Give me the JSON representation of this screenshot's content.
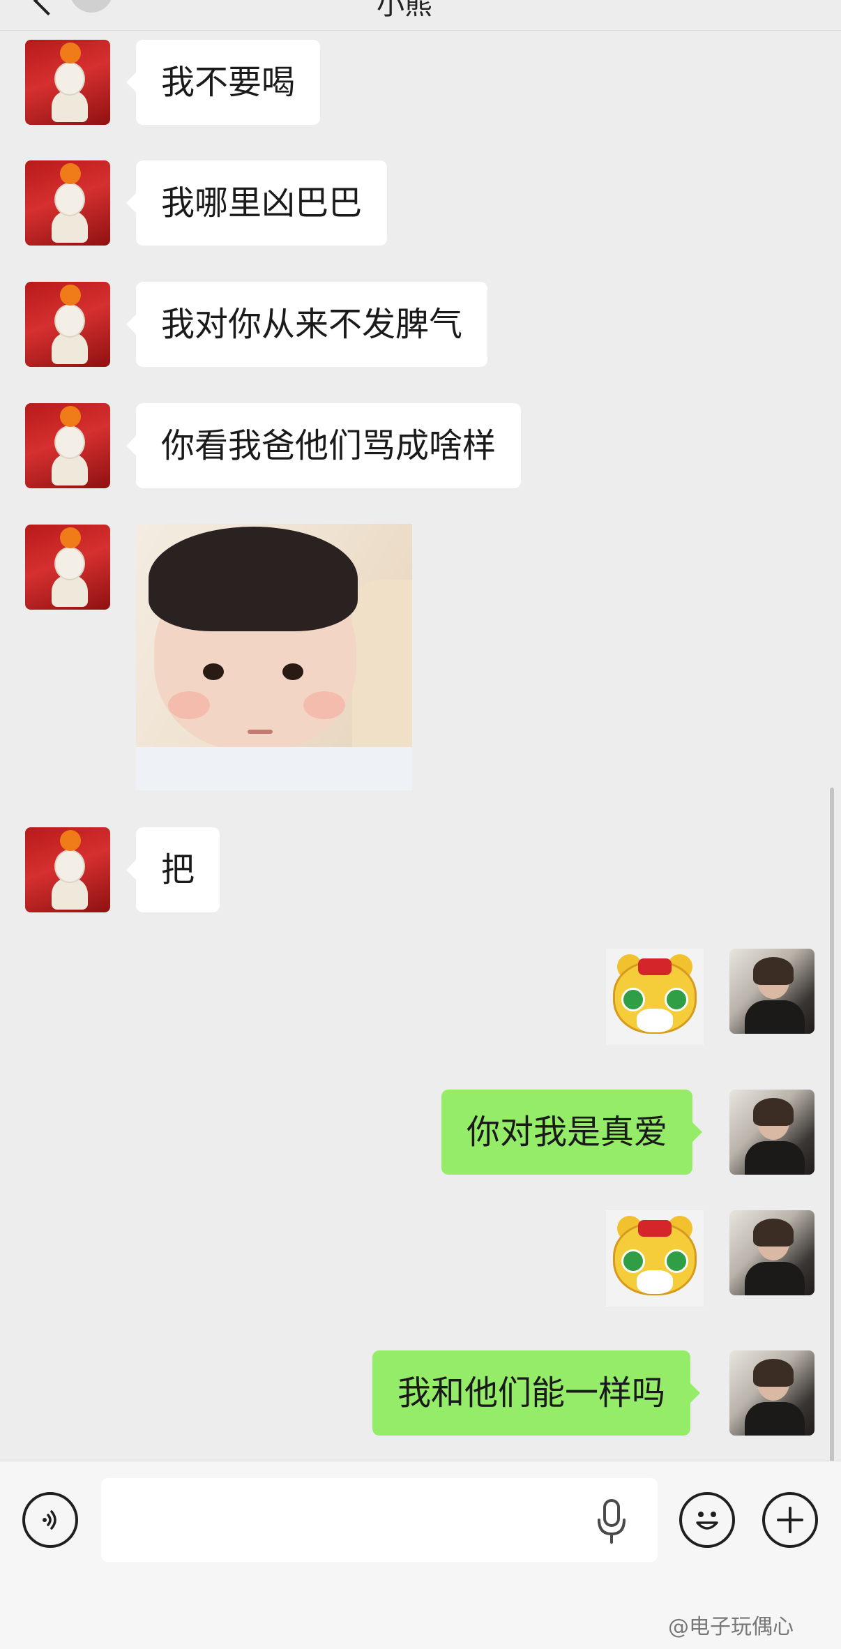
{
  "header": {
    "title": "小熊"
  },
  "messages": [
    {
      "side": "left",
      "type": "text",
      "text": "我不要喝"
    },
    {
      "side": "left",
      "type": "text",
      "text": "我哪里凶巴巴"
    },
    {
      "side": "left",
      "type": "text",
      "text": "我对你从来不发脾气"
    },
    {
      "side": "left",
      "type": "text",
      "text": "你看我爸他们骂成啥样"
    },
    {
      "side": "left",
      "type": "image",
      "image": "baby-photo-sticker"
    },
    {
      "side": "left",
      "type": "text",
      "text": "把"
    },
    {
      "side": "right",
      "type": "sticker",
      "image": "tiger-sticker"
    },
    {
      "side": "right",
      "type": "text",
      "text": "你对我是真爱"
    },
    {
      "side": "right",
      "type": "sticker",
      "image": "tiger-sticker"
    },
    {
      "side": "right",
      "type": "text",
      "text": "我和他们能一样吗"
    }
  ],
  "input_bar": {
    "voice_icon": "voice-icon",
    "mic_icon": "microphone-icon",
    "emoji_icon": "emoji-icon",
    "plus_icon": "plus-icon",
    "input_value": ""
  },
  "watermark": "@电子玩偶心",
  "colors": {
    "background": "#ededed",
    "incoming_bubble": "#ffffff",
    "outgoing_bubble": "#95ec69"
  }
}
